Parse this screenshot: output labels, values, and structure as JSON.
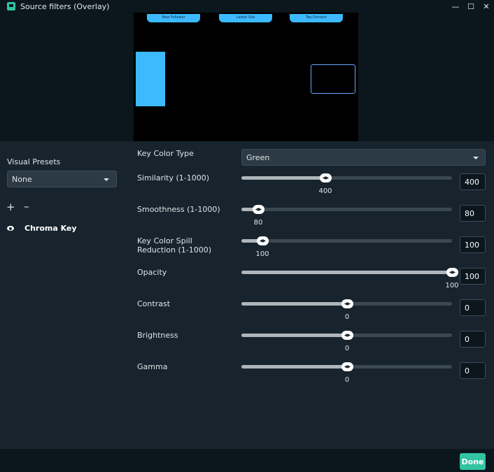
{
  "window": {
    "title": "Source filters (Overlay)"
  },
  "preview": {
    "tabs": [
      "New Follower",
      "Latest Sub",
      "Top Donator"
    ]
  },
  "left": {
    "presets_label": "Visual Presets",
    "preset_value": "None",
    "filters": [
      {
        "name": "Chroma Key"
      }
    ]
  },
  "settings": {
    "key_color_type_label": "Key Color Type",
    "key_color_type_value": "Green",
    "sliders": [
      {
        "label": "Similarity (1-1000)",
        "value": "400",
        "fraction": 0.4
      },
      {
        "label": "Smoothness (1-1000)",
        "value": "80",
        "fraction": 0.08
      },
      {
        "label": "Key Color Spill Reduction (1-1000)",
        "value": "100",
        "fraction": 0.1
      },
      {
        "label": "Opacity",
        "value": "100",
        "fraction": 1.0
      },
      {
        "label": "Contrast",
        "value": "0",
        "fraction": 0.5
      },
      {
        "label": "Brightness",
        "value": "0",
        "fraction": 0.5
      },
      {
        "label": "Gamma",
        "value": "0",
        "fraction": 0.5
      }
    ]
  },
  "footer": {
    "done_label": "Done"
  },
  "colors": {
    "accent": "#31c3a2",
    "preview_blue": "#3db9ff"
  }
}
